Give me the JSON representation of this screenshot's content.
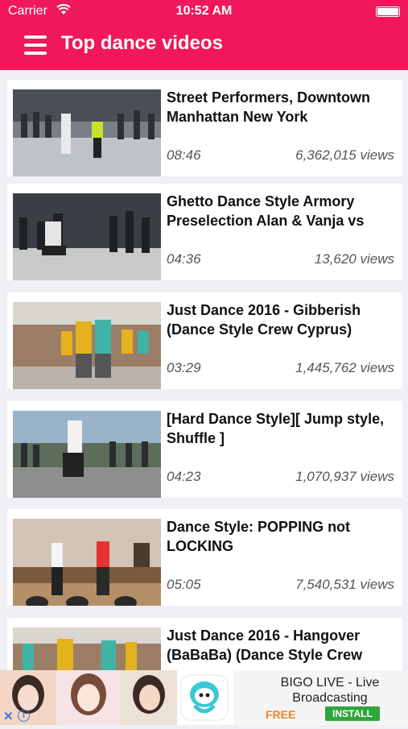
{
  "status_bar": {
    "carrier": "Carrier",
    "wifi_icon": "wifi-icon",
    "time": "10:52 AM",
    "battery_icon": "battery-icon"
  },
  "nav": {
    "menu_icon": "hamburger-menu-icon",
    "title": "Top dance videos",
    "color": "#f0185a"
  },
  "videos": [
    {
      "title": "Street Performers, Downtown Manhattan New York",
      "duration": "08:46",
      "views": "6,362,015 views"
    },
    {
      "title": "Ghetto Dance Style Armory Preselection Alan & Vanja vs",
      "duration": "04:36",
      "views": "13,620 views"
    },
    {
      "title": "Just Dance 2016 - Gibberish (Dance Style Crew Cyprus)",
      "duration": "03:29",
      "views": "1,445,762 views"
    },
    {
      "title": "[Hard Dance Style][ Jump style, Shuffle ]",
      "duration": "04:23",
      "views": "1,070,937 views"
    },
    {
      "title": "Dance Style: POPPING not LOCKING",
      "duration": "05:05",
      "views": "7,540,531 views"
    },
    {
      "title": "Just Dance 2016 - Hangover (BaBaBa) (Dance Style Crew",
      "duration": "",
      "views": ""
    }
  ],
  "ad": {
    "title": "BIGO LIVE - Live Broadcasting",
    "free": "FREE",
    "install": "INSTALL",
    "close_icon": "close-x-icon",
    "info_icon": "info-icon",
    "install_color": "#2ea53b",
    "free_color": "#f0861e"
  }
}
